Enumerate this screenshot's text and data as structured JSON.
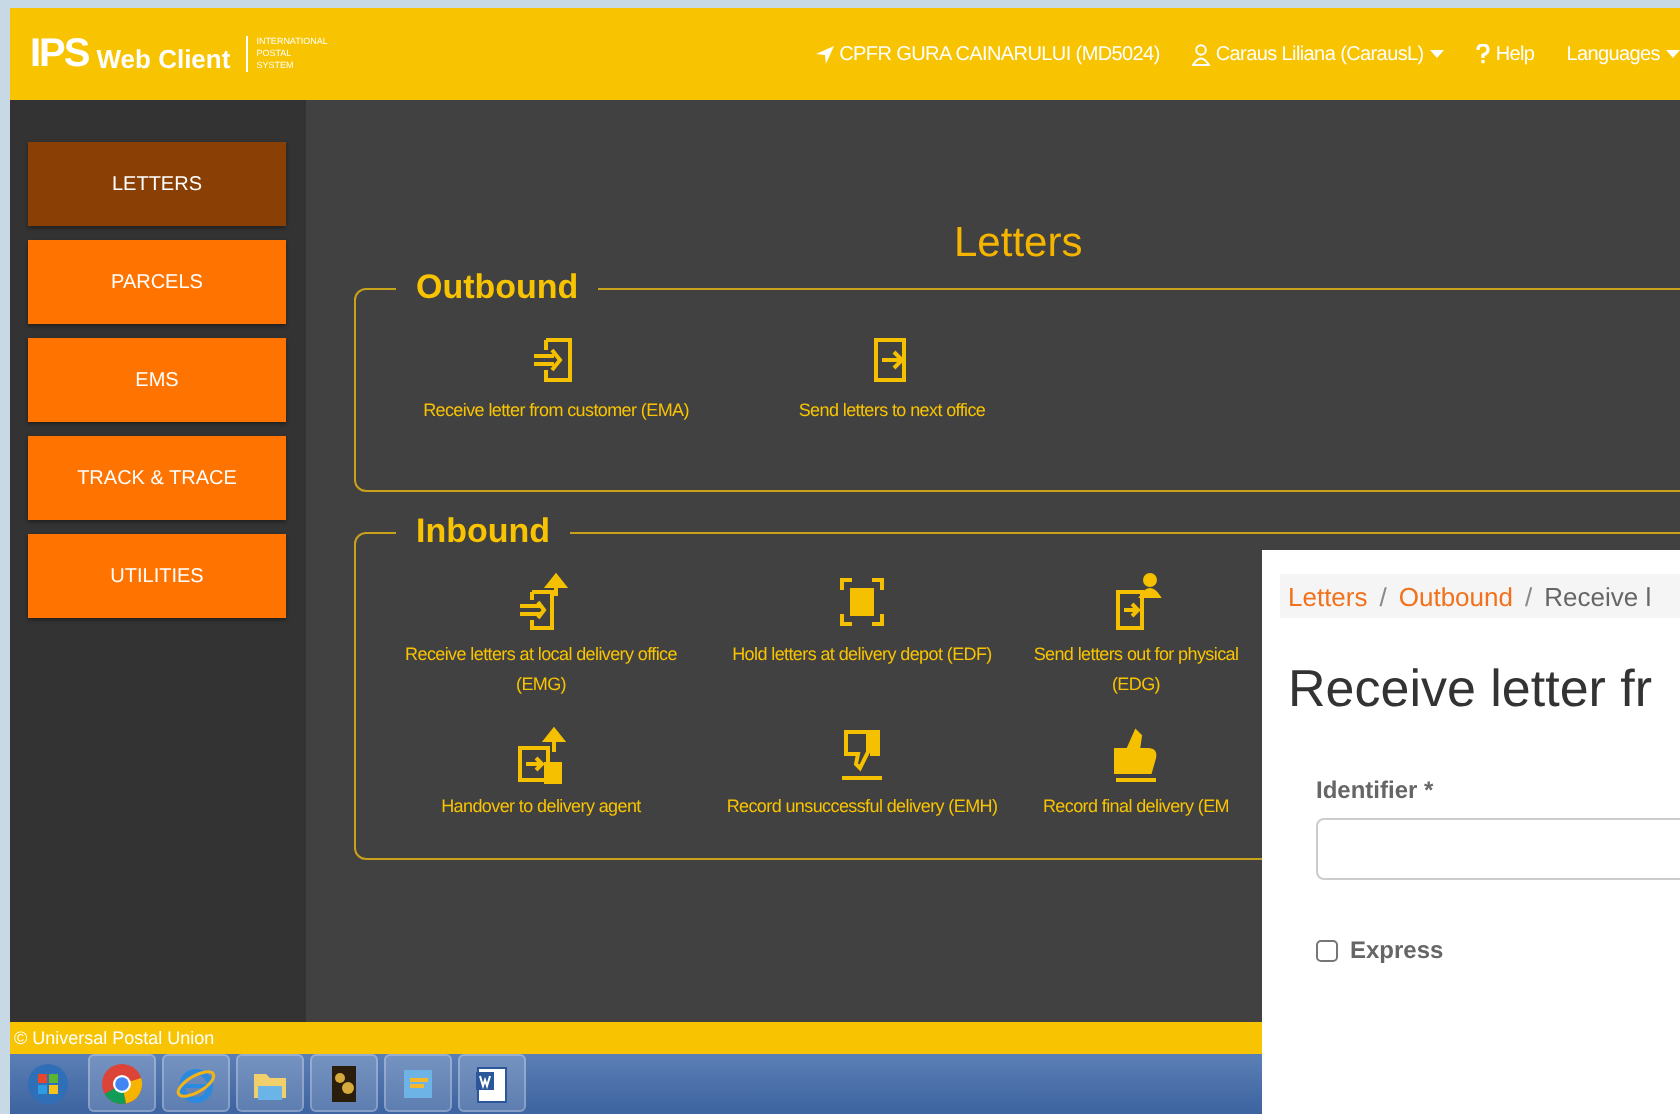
{
  "header": {
    "logo": {
      "mark": "IPS",
      "name": "Web Client",
      "tagline": [
        "INTERNATIONAL",
        "POSTAL",
        "SYSTEM"
      ]
    },
    "nav": [
      {
        "kind": "location",
        "label": "CPFR GURA CAINARULUI (MD5024)"
      },
      {
        "kind": "user",
        "label": "Caraus Liliana (CarausL)"
      },
      {
        "kind": "help",
        "label": "Help"
      },
      {
        "kind": "languages",
        "label": "Languages"
      }
    ]
  },
  "sidebar": {
    "items": [
      {
        "label": "LETTERS",
        "selected": true
      },
      {
        "label": "PARCELS",
        "selected": false
      },
      {
        "label": "EMS",
        "selected": false
      },
      {
        "label": "TRACK & TRACE",
        "selected": false
      },
      {
        "label": "UTILITIES",
        "selected": false
      }
    ]
  },
  "page_title": "Letters",
  "sections": [
    {
      "title": "Outbound",
      "items": [
        {
          "kind": "enter",
          "label": [
            "Receive letter from customer (EMA)"
          ]
        },
        {
          "kind": "exit",
          "label": [
            "Send letters to next office"
          ]
        }
      ]
    },
    {
      "title": "Inbound",
      "items": [
        {
          "kind": "enter-up",
          "label": [
            "Receive letters at local delivery office",
            "(EMG)"
          ]
        },
        {
          "kind": "hold",
          "label": [
            "Hold letters at delivery depot (EDF)"
          ]
        },
        {
          "kind": "exit-person",
          "label": [
            "Send letters out for physical",
            "(EDG)"
          ]
        },
        {
          "kind": "exit-doc-up",
          "label": [
            "Handover to delivery agent"
          ]
        },
        {
          "kind": "thumb-down",
          "label": [
            "Record unsuccessful delivery (EMH)"
          ]
        },
        {
          "kind": "thumb-up",
          "label": [
            "Record final delivery (EM"
          ]
        }
      ]
    }
  ],
  "footer": "© Universal Postal Union",
  "taskbar": [
    {
      "kind": "start"
    },
    {
      "kind": "chrome"
    },
    {
      "kind": "ie"
    },
    {
      "kind": "folder"
    },
    {
      "kind": "photo"
    },
    {
      "kind": "app"
    },
    {
      "kind": "word"
    }
  ],
  "form_panel": {
    "breadcrumb": [
      {
        "label": "Letters",
        "link": true
      },
      {
        "sep": "/",
        "label": "Outbound",
        "link": true
      },
      {
        "sep": "/",
        "label": "Receive l",
        "link": false
      }
    ],
    "title": "Receive letter fr",
    "identifier": {
      "label": "Identifier *"
    },
    "express": {
      "label": "Express",
      "checked": false
    }
  }
}
